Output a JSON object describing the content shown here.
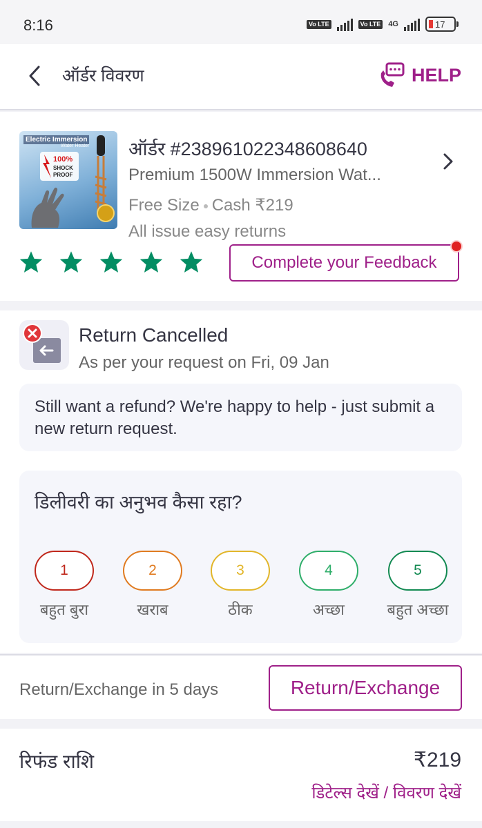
{
  "status_bar": {
    "time": "8:16",
    "volte_badge": "Vo LTE",
    "network": "4G",
    "battery": "17"
  },
  "header": {
    "title": "ऑर्डर विवरण",
    "help_label": "HELP"
  },
  "order": {
    "order_number": "ऑर्डर #238961022348608640",
    "product_name": "Premium 1500W Immersion Wat...",
    "size": "Free Size",
    "payment": "Cash ₹219",
    "returns_note": "All issue easy returns",
    "image_text": {
      "brand": "Electric Immersion",
      "sub": "Water Heater",
      "badge": "100% SHOCK PROOF"
    },
    "rating_stars": 5,
    "feedback_button": "Complete your Feedback"
  },
  "return_status": {
    "title": "Return Cancelled",
    "subtitle": "As per your request on Fri, 09 Jan",
    "refund_message": "Still want a refund? We're happy to help - just submit a new return request."
  },
  "delivery_rating": {
    "question": "डिलीवरी का अनुभव कैसा रहा?",
    "options": [
      {
        "value": "1",
        "label": "बहुत बुरा",
        "color": "#c0281c"
      },
      {
        "value": "2",
        "label": "खराब",
        "color": "#e07b20"
      },
      {
        "value": "3",
        "label": "ठीक",
        "color": "#e2b62a"
      },
      {
        "value": "4",
        "label": "अच्छा",
        "color": "#2fae6a"
      },
      {
        "value": "5",
        "label": "बहुत अच्छा",
        "color": "#138a52"
      }
    ]
  },
  "return_window": {
    "text": "Return/Exchange in 5 days",
    "button": "Return/Exchange"
  },
  "refund": {
    "label": "रिफंड राशि",
    "amount": "₹219",
    "details_link": "डिटेल्स देखें / विवरण देखें"
  },
  "colors": {
    "accent": "#9f2089",
    "star": "#038d63"
  }
}
